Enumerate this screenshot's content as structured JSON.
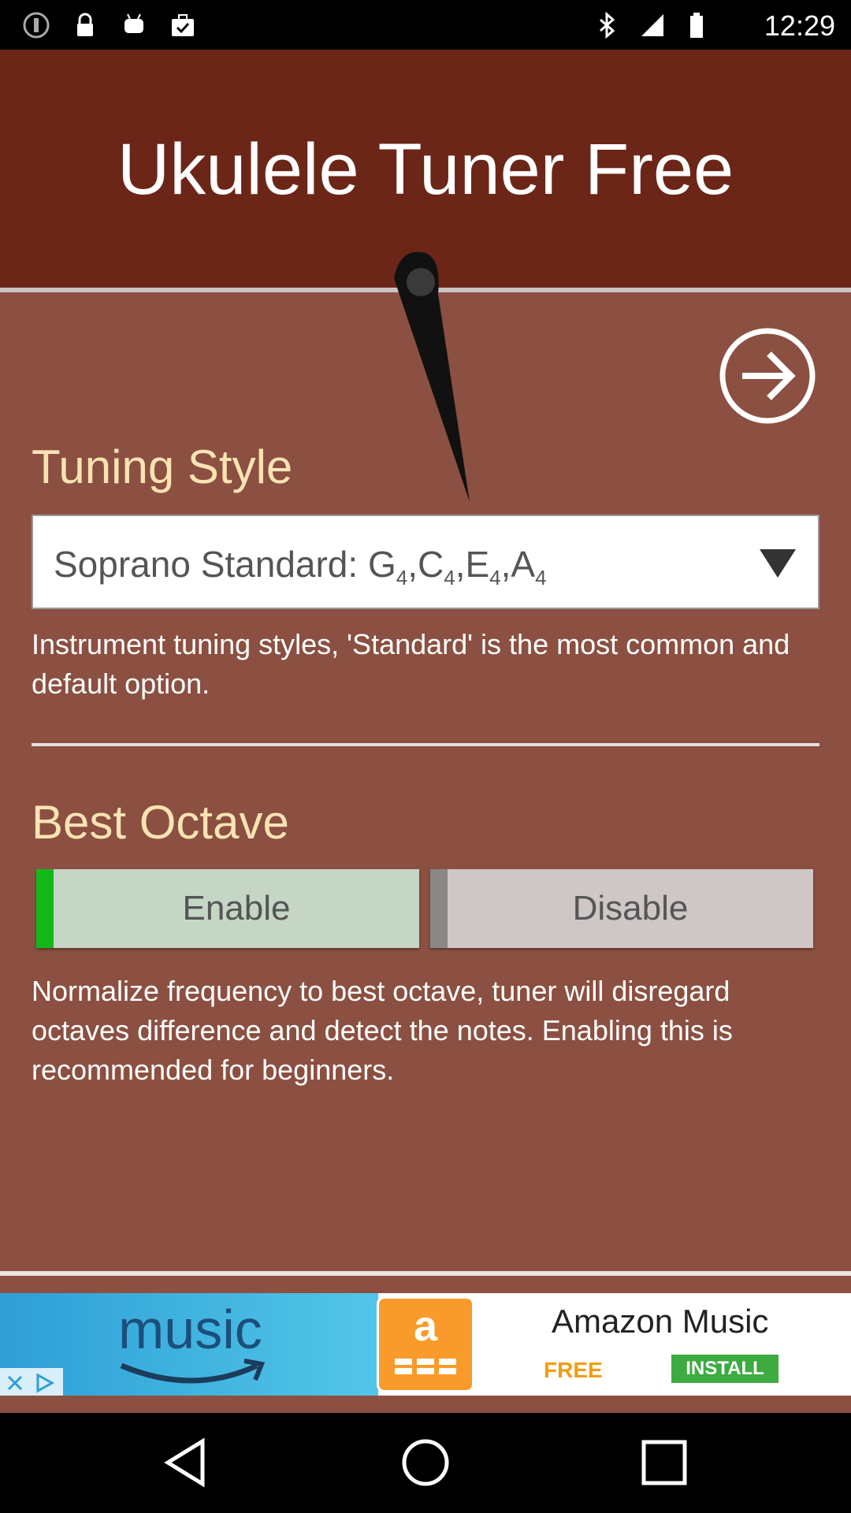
{
  "status_bar": {
    "time": "12:29",
    "left_icons": [
      "info-icon",
      "lock-icon",
      "android-icon",
      "briefcase-check-icon"
    ],
    "right_icons": [
      "bluetooth-icon",
      "signal-icon",
      "battery-icon"
    ]
  },
  "app": {
    "title": "Ukulele Tuner Free",
    "next_icon": "arrow-right-circle-icon"
  },
  "tuning_style": {
    "heading": "Tuning Style",
    "selected_prefix": "Soprano Standard: ",
    "selected_notes": [
      {
        "note": "G",
        "octave": "4",
        "sep": ","
      },
      {
        "note": "C",
        "octave": "4",
        "sep": ","
      },
      {
        "note": "E",
        "octave": "4",
        "sep": ","
      },
      {
        "note": "A",
        "octave": "4",
        "sep": ""
      }
    ],
    "description": "Instrument tuning styles, 'Standard' is the most common and default option."
  },
  "best_octave": {
    "heading": "Best Octave",
    "enable_label": "Enable",
    "disable_label": "Disable",
    "selected": "Enable",
    "description": "Normalize frequency to best octave, tuner will disregard octaves difference and detect the notes. Enabling this is recommended for beginners."
  },
  "ad": {
    "left_text": "music",
    "app_icon_letter": "a",
    "name": "Amazon Music",
    "price": "FREE",
    "cta": "INSTALL"
  },
  "nav": {
    "back_icon": "back-triangle-icon",
    "home_icon": "home-circle-icon",
    "recents_icon": "recents-square-icon"
  },
  "colors": {
    "header_bg": "#6b2618",
    "body_bg": "#8b5041",
    "heading_color": "#fbe3b3",
    "enable_accent": "#12b81a"
  }
}
